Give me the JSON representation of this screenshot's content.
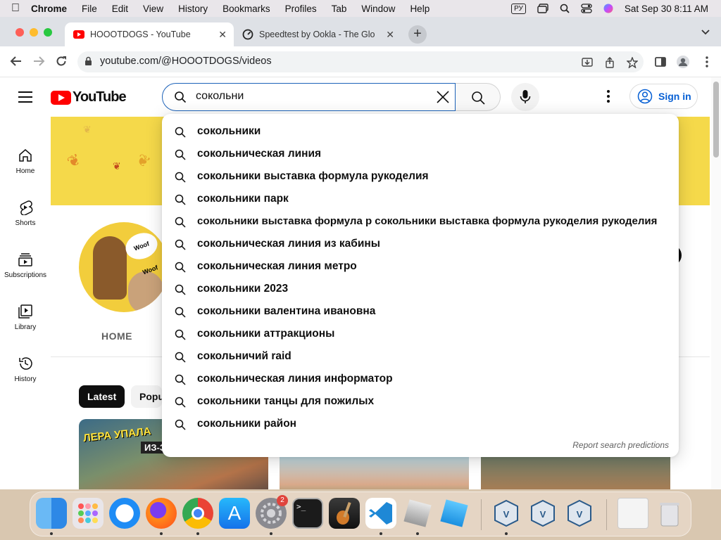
{
  "menubar": {
    "app": "Chrome",
    "items": [
      "File",
      "Edit",
      "View",
      "History",
      "Bookmarks",
      "Profiles",
      "Tab",
      "Window",
      "Help"
    ],
    "keyboard_layout": "РУ",
    "datetime": "Sat Sep 30  8:11 AM"
  },
  "browser": {
    "tabs": [
      {
        "title": "HOOOTDOGS - YouTube",
        "active": true,
        "icon": "youtube-icon"
      },
      {
        "title": "Speedtest by Ookla - The Glo",
        "active": false,
        "icon": "speedtest-icon"
      }
    ],
    "url": "youtube.com/@HOOOTDOGS/videos"
  },
  "youtube": {
    "logo_text": "YouTube",
    "search_query": "сокольни",
    "signin_label": "Sign in",
    "sidebar": [
      {
        "label": "Home",
        "icon": "home-icon"
      },
      {
        "label": "Shorts",
        "icon": "shorts-icon"
      },
      {
        "label": "Subscriptions",
        "icon": "subscriptions-icon"
      },
      {
        "label": "Library",
        "icon": "library-icon"
      },
      {
        "label": "History",
        "icon": "history-icon"
      }
    ],
    "avatar_bubble": "Woof Woof",
    "channel_tab": "HOME",
    "chips": [
      "Latest",
      "Popular"
    ],
    "thumbnails": [
      {
        "overlay_line1": "ЛЕРА УПАЛА",
        "overlay_line2": "ИЗ-ЗА"
      }
    ]
  },
  "suggestions": {
    "items": [
      "сокольники",
      "сокольническая линия",
      "сокольники выставка формула рукоделия",
      "сокольники парк",
      "сокольники выставка формула р сокольники выставка формула рукоделия рукоделия",
      "сокольническая линия из кабины",
      "сокольническая линия метро",
      "сокольники 2023",
      "сокольники валентина ивановна",
      "сокольники аттракционы",
      "сокольничий raid",
      "сокольническая линия информатор",
      "сокольники танцы для пожилых",
      "сокольники район"
    ],
    "report_label": "Report search predictions"
  },
  "dock": {
    "apps": [
      "Finder",
      "Launchpad",
      "Safari",
      "Firefox",
      "Chrome",
      "App Store",
      "System Settings",
      "Terminal",
      "GarageBand",
      "Visual Studio Code",
      "Roblox Studio",
      "Roblox",
      "VirtualBox",
      "VirtualBox",
      "VirtualBox",
      "Window Preview",
      "Trash"
    ],
    "settings_badge": "2"
  }
}
